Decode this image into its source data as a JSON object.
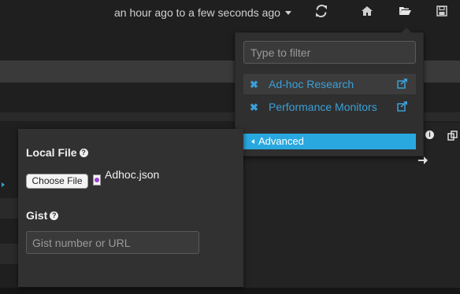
{
  "nav": {
    "time_range": "an hour ago to a few seconds ago",
    "icons": [
      "refresh-icon",
      "home-icon",
      "folder-open-icon",
      "save-icon"
    ]
  },
  "load_dropdown": {
    "filter_placeholder": "Type to filter",
    "dashboards": [
      {
        "name": "Ad-hoc Research",
        "active": true
      },
      {
        "name": "Performance Monitors",
        "active": false
      }
    ],
    "advanced_label": "Advanced"
  },
  "local_file": {
    "title": "Local File",
    "help": "?",
    "choose_button": "Choose File",
    "file_name": "Adhoc.json"
  },
  "gist": {
    "title": "Gist",
    "help": "?",
    "placeholder": "Gist number or URL"
  },
  "panel": {
    "info": "i"
  },
  "colors": {
    "accent": "#29a8e0",
    "link": "#3aa0d8",
    "background": "#1f1f1f"
  }
}
